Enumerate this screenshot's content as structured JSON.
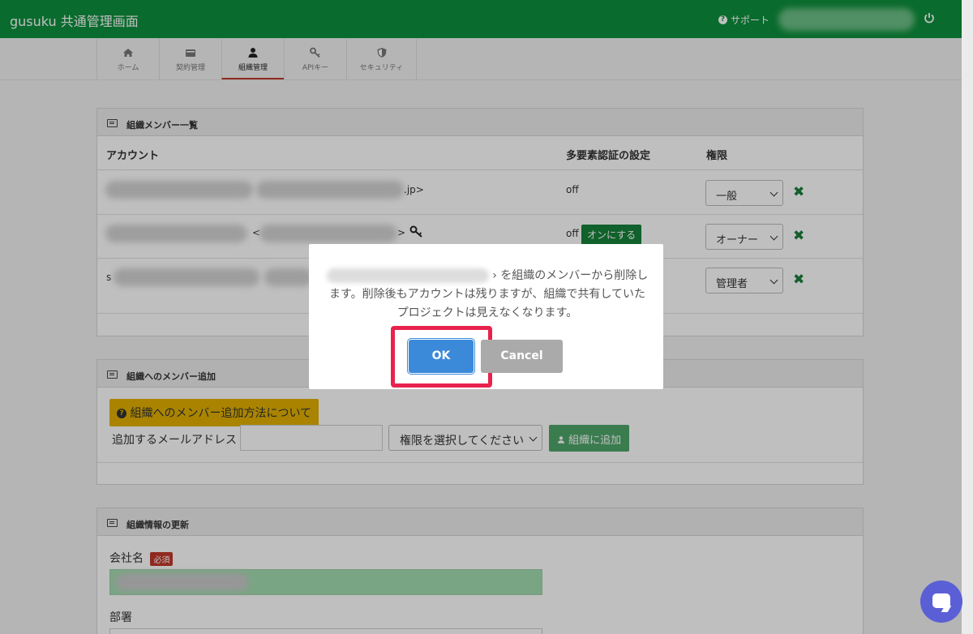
{
  "header": {
    "title": "gusuku 共通管理画面",
    "support": "サポート"
  },
  "tabs": [
    {
      "label": "ホーム",
      "icon": "home-icon"
    },
    {
      "label": "契約管理",
      "icon": "card-icon"
    },
    {
      "label": "組織管理",
      "icon": "user-icon",
      "active": true
    },
    {
      "label": "APIキー",
      "icon": "key-icon"
    },
    {
      "label": "セキュリティ",
      "icon": "shield-icon"
    }
  ],
  "members": {
    "title": "組織メンバー一覧",
    "columns": {
      "account": "アカウント",
      "mfa": "多要素認証の設定",
      "role": "権限"
    },
    "rows": [
      {
        "account_tail": ".jp>",
        "mfa": "off",
        "role": "一般"
      },
      {
        "account_tail": ">",
        "account_mid": "<",
        "mfa": "off",
        "mfa_button": "オンにする",
        "role": "オーナー"
      },
      {
        "account_head": "s",
        "mfa": "",
        "role": "管理者"
      }
    ]
  },
  "add_member": {
    "title": "組織へのメンバー追加",
    "help_button": "組織へのメンバー追加方法について",
    "email_label": "追加するメールアドレス",
    "role_select": "権限を選択してください",
    "add_button": "組織に追加"
  },
  "org_update": {
    "title": "組織情報の更新",
    "company_label": "会社名",
    "required_badge": "必須",
    "department_label": "部署"
  },
  "modal": {
    "message_prefix": "›",
    "message": "を組織のメンバーから削除します。削除後もアカウントは残りますが、組織で共有していたプロジェクトは見えなくなります。",
    "ok": "OK",
    "cancel": "Cancel"
  },
  "colors": {
    "header": "#0d8f3c",
    "highlight": "#e8224d",
    "ok": "#3b8ad9"
  }
}
